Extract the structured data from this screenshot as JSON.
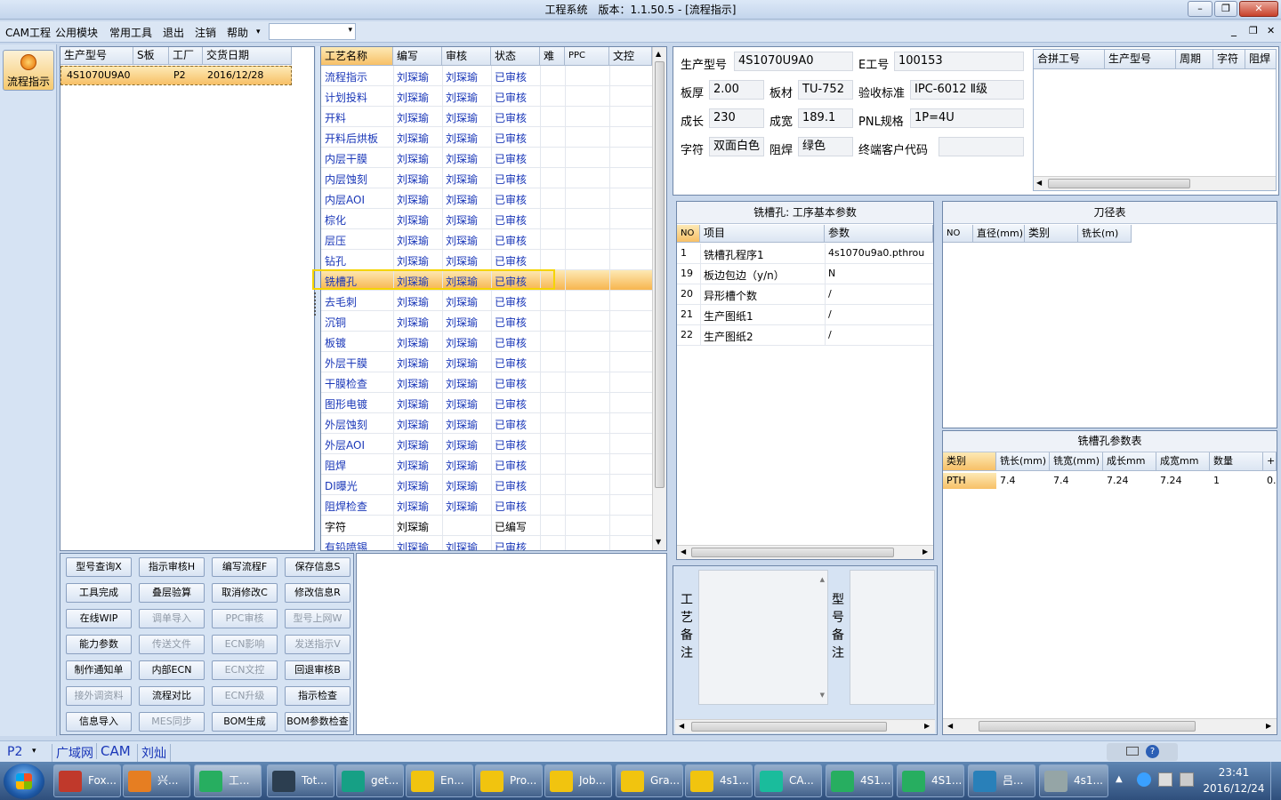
{
  "window": {
    "title": "工程系统　版本：1.1.50.5 - [流程指示]",
    "min": "–",
    "max": "❐",
    "close": "✕"
  },
  "menu": [
    "CAM工程",
    "公用模块",
    "常用工具",
    "退出",
    "注销",
    "帮助"
  ],
  "menu_dropdown_arrow": "▾",
  "mdi": {
    "min": "_",
    "restore": "❐",
    "close": "✕"
  },
  "leftstrip": {
    "label": "流程指示"
  },
  "orders": {
    "headers": [
      "生产型号",
      "S板",
      "工厂",
      "交货日期"
    ],
    "rows": [
      [
        "4S1070U9A0",
        "",
        "P2",
        "2016/12/28"
      ]
    ]
  },
  "process": {
    "headers": [
      "工艺名称",
      "编写",
      "审核",
      "状态",
      "难",
      "PPC",
      "文控"
    ],
    "rows": [
      [
        "流程指示",
        "刘琛瑜",
        "刘琛瑜",
        "已审核"
      ],
      [
        "计划投料",
        "刘琛瑜",
        "刘琛瑜",
        "已审核"
      ],
      [
        "开料",
        "刘琛瑜",
        "刘琛瑜",
        "已审核"
      ],
      [
        "开料后烘板",
        "刘琛瑜",
        "刘琛瑜",
        "已审核"
      ],
      [
        "内层干膜",
        "刘琛瑜",
        "刘琛瑜",
        "已审核"
      ],
      [
        "内层蚀刻",
        "刘琛瑜",
        "刘琛瑜",
        "已审核"
      ],
      [
        "内层AOI",
        "刘琛瑜",
        "刘琛瑜",
        "已审核"
      ],
      [
        "棕化",
        "刘琛瑜",
        "刘琛瑜",
        "已审核"
      ],
      [
        "层压",
        "刘琛瑜",
        "刘琛瑜",
        "已审核"
      ],
      [
        "钻孔",
        "刘琛瑜",
        "刘琛瑜",
        "已审核"
      ],
      [
        "铣槽孔",
        "刘琛瑜",
        "刘琛瑜",
        "已审核"
      ],
      [
        "去毛刺",
        "刘琛瑜",
        "刘琛瑜",
        "已审核"
      ],
      [
        "沉铜",
        "刘琛瑜",
        "刘琛瑜",
        "已审核"
      ],
      [
        "板镀",
        "刘琛瑜",
        "刘琛瑜",
        "已审核"
      ],
      [
        "外层干膜",
        "刘琛瑜",
        "刘琛瑜",
        "已审核"
      ],
      [
        "干膜检查",
        "刘琛瑜",
        "刘琛瑜",
        "已审核"
      ],
      [
        "图形电镀",
        "刘琛瑜",
        "刘琛瑜",
        "已审核"
      ],
      [
        "外层蚀刻",
        "刘琛瑜",
        "刘琛瑜",
        "已审核"
      ],
      [
        "外层AOI",
        "刘琛瑜",
        "刘琛瑜",
        "已审核"
      ],
      [
        "阻焊",
        "刘琛瑜",
        "刘琛瑜",
        "已审核"
      ],
      [
        "DI曝光",
        "刘琛瑜",
        "刘琛瑜",
        "已审核"
      ],
      [
        "阻焊检查",
        "刘琛瑜",
        "刘琛瑜",
        "已审核"
      ],
      [
        "字符",
        "刘琛瑜",
        "",
        "已编写"
      ],
      [
        "有铅喷锡",
        "刘琛瑜",
        "刘琛瑜",
        "已审核"
      ]
    ],
    "selected_index": 10
  },
  "buttons": [
    [
      {
        "t": "型号查询X",
        "d": false
      },
      {
        "t": "指示审核H",
        "d": false
      },
      {
        "t": "编写流程F",
        "d": false
      },
      {
        "t": "保存信息S",
        "d": false
      }
    ],
    [
      {
        "t": "工具完成",
        "d": false
      },
      {
        "t": "叠层验算",
        "d": false
      },
      {
        "t": "取消修改C",
        "d": false
      },
      {
        "t": "修改信息R",
        "d": false
      }
    ],
    [
      {
        "t": "在线WIP",
        "d": false
      },
      {
        "t": "调单导入",
        "d": true
      },
      {
        "t": "PPC审核",
        "d": true
      },
      {
        "t": "型号上网W",
        "d": true
      }
    ],
    [
      {
        "t": "能力参数",
        "d": false
      },
      {
        "t": "传送文件",
        "d": true
      },
      {
        "t": "ECN影响",
        "d": true
      },
      {
        "t": "发送指示V",
        "d": true
      }
    ],
    [
      {
        "t": "制作通知单",
        "d": false
      },
      {
        "t": "内部ECN",
        "d": false
      },
      {
        "t": "ECN文控",
        "d": true
      },
      {
        "t": "回退审核B",
        "d": false
      }
    ],
    [
      {
        "t": "接外调资料",
        "d": true
      },
      {
        "t": "流程对比",
        "d": false
      },
      {
        "t": "ECN升级",
        "d": true
      },
      {
        "t": "指示检查",
        "d": false
      }
    ],
    [
      {
        "t": "信息导入",
        "d": false
      },
      {
        "t": "MES同步",
        "d": true
      },
      {
        "t": "BOM生成",
        "d": false
      },
      {
        "t": "BOM参数检查",
        "d": false
      }
    ]
  ],
  "info": {
    "model_label": "生产型号",
    "model": "4S1070U9A0",
    "eno_label": "E工号",
    "eno": "100153",
    "thick_label": "板厚",
    "thick": "2.00",
    "material_label": "板材",
    "material": "TU-752",
    "std_label": "验收标准",
    "std": "IPC-6012 Ⅱ级",
    "len_label": "成长",
    "len": "230",
    "wid_label": "成宽",
    "wid": "189.1",
    "pnl_label": "PNL规格",
    "pnl": "1P=4U",
    "char_label": "字符",
    "char": "双面白色",
    "mask_label": "阻焊",
    "mask": "绿色",
    "cust_label": "终端客户代码",
    "cust": ""
  },
  "combined": {
    "headers": [
      "合拼工号",
      "生产型号",
      "周期",
      "字符",
      "阻焊"
    ]
  },
  "params": {
    "title": "铣槽孔: 工序基本参数",
    "headers": [
      "NO",
      "项目",
      "参数"
    ],
    "rows": [
      [
        "1",
        "铣槽孔程序1",
        "4s1070u9a0.pthrou"
      ],
      [
        "19",
        "板边包边（y/n）",
        "N"
      ],
      [
        "20",
        "异形槽个数",
        "/"
      ],
      [
        "21",
        "生产图纸1",
        "/"
      ],
      [
        "22",
        "生产图纸2",
        "/"
      ]
    ]
  },
  "tools": {
    "title": "刀径表",
    "headers": [
      "NO",
      "直径(mm)",
      "类别",
      "铣长(m)"
    ]
  },
  "slot": {
    "title": "铣槽孔参数表",
    "headers": [
      "类别",
      "铣长(mm)",
      "铣宽(mm)",
      "成长mm",
      "成宽mm",
      "数量",
      "+"
    ],
    "rows": [
      [
        "PTH",
        "7.4",
        "7.4",
        "7.24",
        "7.24",
        "1",
        "0."
      ]
    ]
  },
  "notes": {
    "process_note": "工艺备注",
    "model_note": "型号备注"
  },
  "status": {
    "plant": "P2",
    "net": "广域网",
    "cam": "CAM",
    "user": "刘灿"
  },
  "taskbar": {
    "items": [
      "Fox...",
      "兴...",
      "工...",
      "Tot...",
      "get...",
      "En...",
      "Pro...",
      "Job...",
      "Gra...",
      "4s1...",
      "CA...",
      "4S1...",
      "4S1...",
      "吕...",
      "4s1..."
    ],
    "time": "23:41",
    "date": "2016/12/24"
  }
}
